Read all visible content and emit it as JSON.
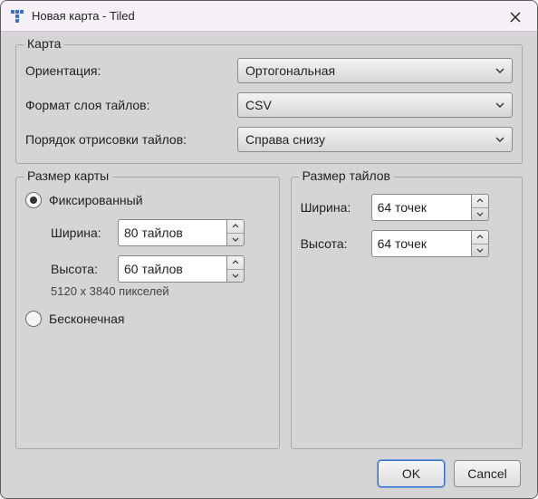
{
  "title": "Новая карта - Tiled",
  "mapGroup": {
    "legend": "Карта",
    "orientationLabel": "Ориентация:",
    "orientationValue": "Ортогональная",
    "layerFormatLabel": "Формат слоя тайлов:",
    "layerFormatValue": "CSV",
    "renderOrderLabel": "Порядок отрисовки тайлов:",
    "renderOrderValue": "Справа снизу"
  },
  "mapSize": {
    "legend": "Размер карты",
    "fixedLabel": "Фиксированный",
    "infiniteLabel": "Бесконечная",
    "widthLabel": "Ширина:",
    "widthValue": "80 тайлов",
    "heightLabel": "Высота:",
    "heightValue": "60 тайлов",
    "hint": "5120 x 3840 пикселей"
  },
  "tileSize": {
    "legend": "Размер тайлов",
    "widthLabel": "Ширина:",
    "widthValue": "64 точек",
    "heightLabel": "Высота:",
    "heightValue": "64 точек"
  },
  "buttons": {
    "ok": "OK",
    "cancel": "Cancel"
  }
}
